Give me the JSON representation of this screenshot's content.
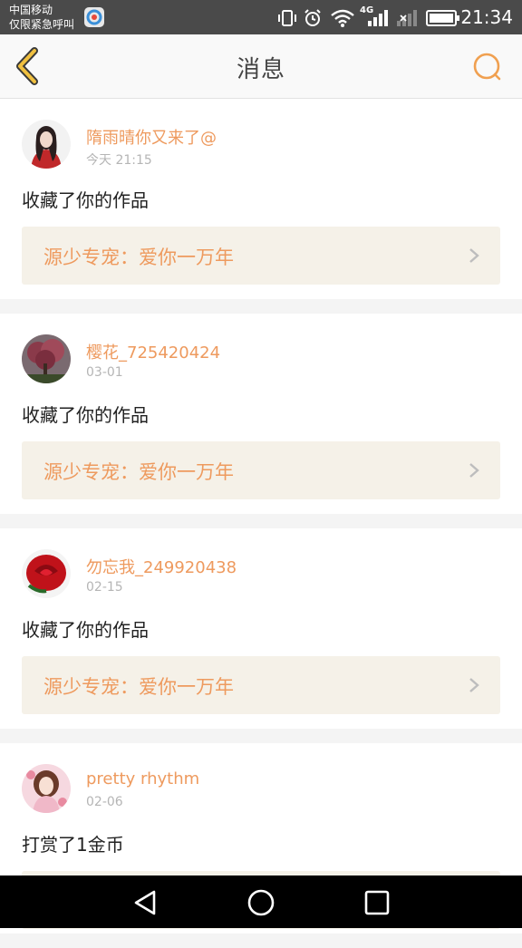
{
  "status_bar": {
    "carrier_line1": "中国移动",
    "carrier_line2": "仅限紧急呼叫",
    "network_label": "4G",
    "time": "21:34",
    "icons": [
      "app-badge-icon",
      "vibrate-icon",
      "alarm-icon",
      "wifi-icon",
      "signal-icon",
      "no-signal-icon",
      "battery-icon"
    ]
  },
  "header": {
    "title": "消息",
    "back_icon": "chevron-left-icon",
    "search_icon": "search-icon",
    "accent_color": "#f0a050"
  },
  "messages": [
    {
      "username": "隋雨晴你又来了@",
      "date": "今天 21:15",
      "action": "收藏了你的作品",
      "work_title": "源少专宠：爱你一万年",
      "avatar": "avatar-girl-red-dress"
    },
    {
      "username": "樱花_725420424",
      "date": "03-01",
      "action": "收藏了你的作品",
      "work_title": "源少专宠：爱你一万年",
      "avatar": "avatar-cherry-tree"
    },
    {
      "username": "勿忘我_249920438",
      "date": "02-15",
      "action": "收藏了你的作品",
      "work_title": "源少专宠：爱你一万年",
      "avatar": "avatar-red-rose"
    },
    {
      "username": "pretty rhythm",
      "date": "02-06",
      "action": "打赏了1金币",
      "work_title": "",
      "avatar": "avatar-girl-pink"
    }
  ],
  "nav_bar": {
    "icons": [
      "back-triangle-icon",
      "home-circle-icon",
      "recents-square-icon"
    ]
  }
}
